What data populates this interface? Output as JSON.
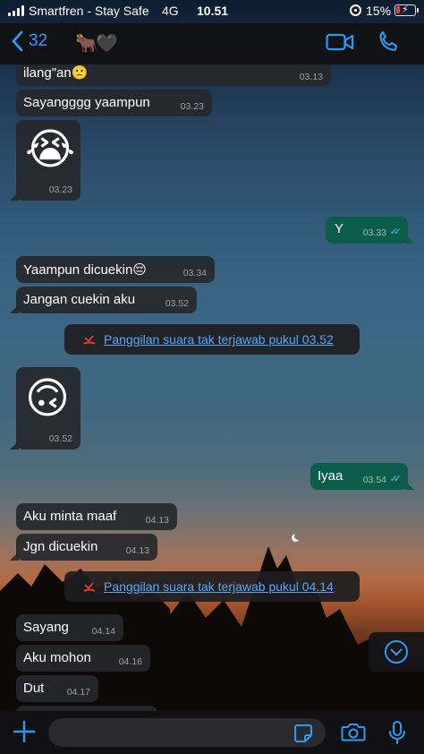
{
  "status_bar": {
    "carrier": "Smartfren - Stay Safe",
    "network": "4G",
    "time": "10.51",
    "battery": "15%"
  },
  "header": {
    "back_count": "32",
    "contact_emoji": "🐂🖤"
  },
  "messages": [
    {
      "dir": "in",
      "text": "ilang\"an🙁",
      "time": "03.13"
    },
    {
      "dir": "in",
      "text": "Sayangggg yaampun",
      "time": "03.23"
    },
    {
      "dir": "in",
      "text": "😭",
      "time": "03.23"
    },
    {
      "dir": "out",
      "text": "Y",
      "time": "03.33"
    },
    {
      "dir": "in",
      "text": "Yaampun dicuekin😔",
      "time": "03.34"
    },
    {
      "dir": "in",
      "text": "Jangan cuekin aku",
      "time": "03.52"
    },
    {
      "dir": "in",
      "text": "🙃",
      "time": "03.52"
    },
    {
      "dir": "out",
      "text": "Iyaa",
      "time": "03.54"
    },
    {
      "dir": "in",
      "text": "Aku minta maaf",
      "time": "04.13"
    },
    {
      "dir": "in",
      "text": "Jgn dicuekin",
      "time": "04.13"
    },
    {
      "dir": "in",
      "text": "Sayang",
      "time": "04.14"
    },
    {
      "dir": "in",
      "text": "Aku mohon",
      "time": "04.16"
    },
    {
      "dir": "in",
      "text": "Dut",
      "time": "04.17"
    }
  ],
  "missed_calls": [
    {
      "text": "Panggilan suara tak terjawab pukul 03.52"
    },
    {
      "text": "Panggilan suara tak terjawab pukul 04.14"
    }
  ],
  "colors": {
    "accent": "#2b9af3",
    "outgoing_bubble": "#0b5c4b",
    "incoming_bubble": "#26282c",
    "missed_call_red": "#ff3b30",
    "read_ticks": "#53bdeb"
  },
  "icons": {
    "back": "chevron-left-icon",
    "video": "video-camera-icon",
    "call": "phone-icon",
    "plus": "plus-icon",
    "sticker": "sticker-icon",
    "camera": "camera-icon",
    "mic": "microphone-icon",
    "scroll_down": "chevron-down-circle-icon",
    "missed_call": "missed-call-icon"
  }
}
